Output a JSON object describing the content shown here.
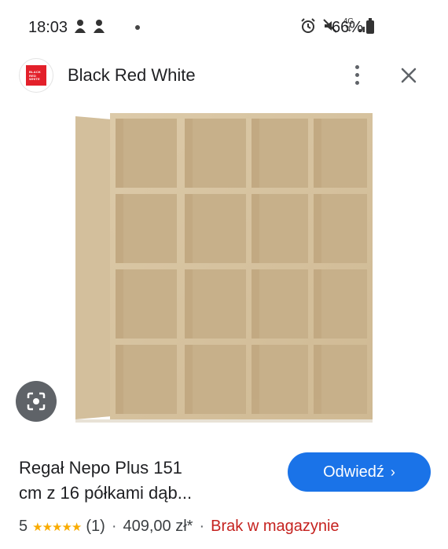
{
  "status_bar": {
    "time": "18:03",
    "network_label": "4G",
    "battery": "66%"
  },
  "header": {
    "brand_name": "Black Red White",
    "logo_text": "BLACK RED WHITE",
    "icons": [
      "more-vert-icon",
      "close-icon"
    ]
  },
  "product": {
    "title_line1": "Regał Nepo Plus 151",
    "title_line2": "cm z 16 półkami dąb...",
    "visit_label": "Odwiedź",
    "visit_arrow": "›",
    "rating": "5",
    "stars": "★★★★★",
    "review_count": "(1)",
    "separator": "·",
    "price": "409,00 zł*",
    "availability": "Brak w magazynie"
  },
  "colors": {
    "accent": "#1a73e8",
    "brand_red": "#e3202a",
    "out_of_stock": "#c5221f",
    "star": "#f9ab00"
  }
}
